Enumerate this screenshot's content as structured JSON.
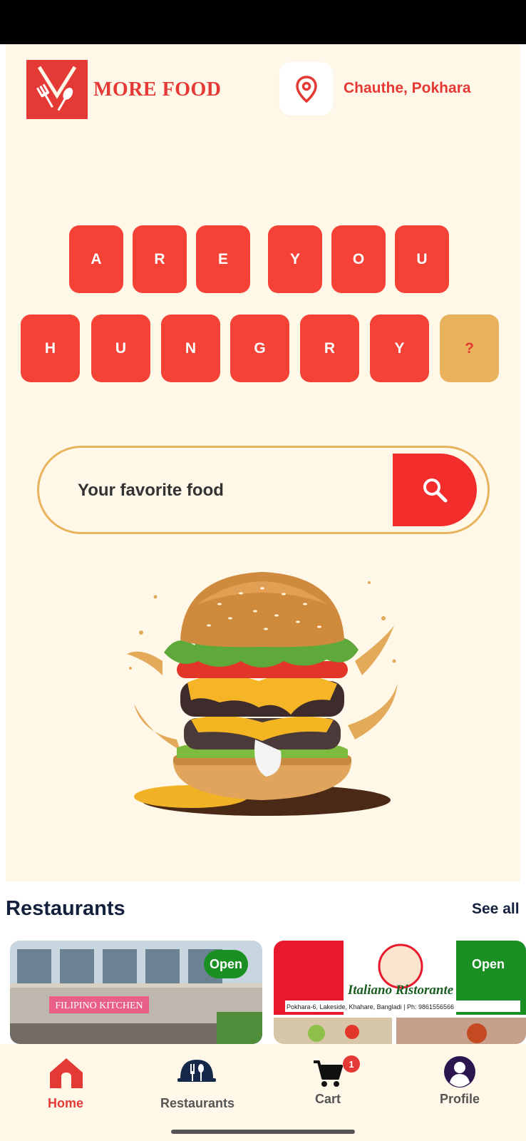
{
  "brand": {
    "name": "MORE FOOD",
    "color": "#e53935"
  },
  "header": {
    "location": "Chauthe, Pokhara"
  },
  "banner": {
    "row1": [
      "A",
      "R",
      "E",
      "Y",
      "O",
      "U"
    ],
    "row2": [
      "H",
      "U",
      "N",
      "G",
      "R",
      "Y"
    ],
    "mark": "?"
  },
  "search": {
    "placeholder": "Your favorite food"
  },
  "restaurants": {
    "title": "Restaurants",
    "see_all": "See all",
    "cards": [
      {
        "status": "Open",
        "sign": "FILIPINO KITCHEN"
      },
      {
        "status": "Open",
        "sign": "Italiano Ristorante",
        "address": "Pokhara-6, Lakeside, Khahare, Bangladi | Ph: 9861556566"
      }
    ]
  },
  "nav": {
    "items": [
      {
        "label": "Home",
        "icon": "home-icon",
        "active": true
      },
      {
        "label": "Restaurants",
        "icon": "restaurant-icon",
        "active": false
      },
      {
        "label": "Cart",
        "icon": "cart-icon",
        "active": false
      },
      {
        "label": "Profile",
        "icon": "profile-icon",
        "active": false
      }
    ],
    "cart_count": "1"
  },
  "colors": {
    "accent": "#f44336",
    "highlight": "#e9b35e",
    "background": "#fff8e8",
    "open_badge": "#1a8f23"
  }
}
